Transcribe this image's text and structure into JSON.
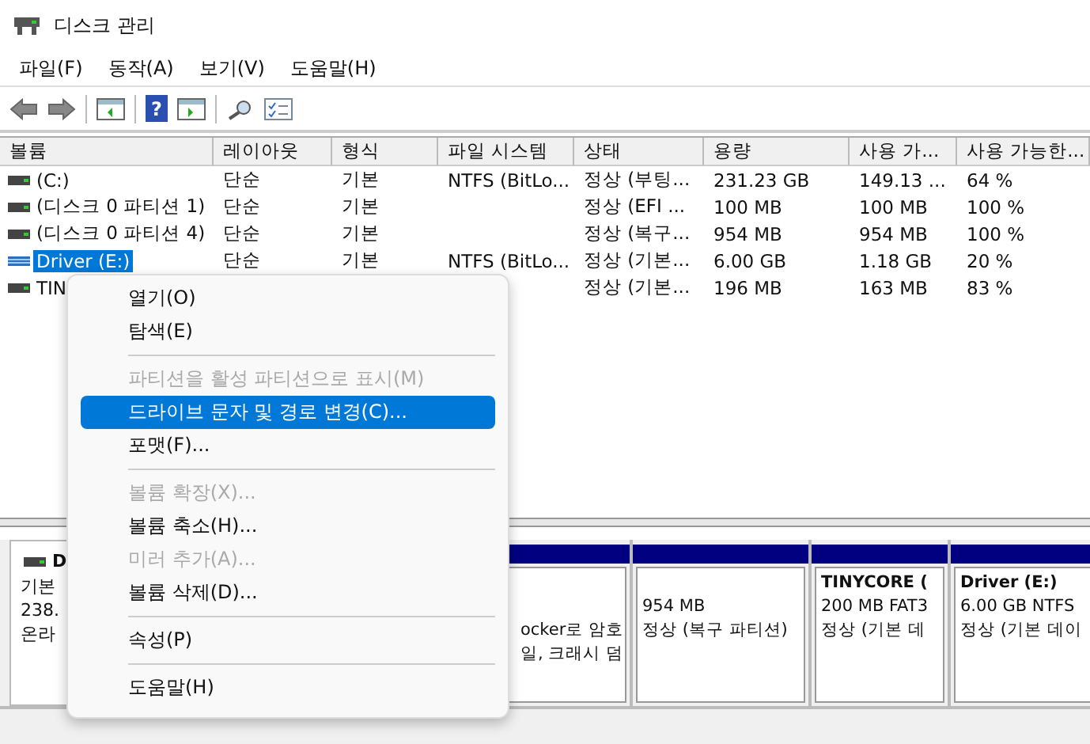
{
  "window": {
    "title": "디스크 관리"
  },
  "menu_bar": [
    "파일(F)",
    "동작(A)",
    "보기(V)",
    "도움말(H)"
  ],
  "toolbar": {
    "help_glyph": "?"
  },
  "table": {
    "columns": [
      "볼륨",
      "레이아웃",
      "형식",
      "파일 시스템",
      "상태",
      "용량",
      "사용 가...",
      "사용 가능한..."
    ],
    "rows": [
      {
        "cells": [
          "(C:)",
          "단순",
          "기본",
          "NTFS (BitLo...",
          "정상 (부팅...",
          "231.23 GB",
          "149.13 ...",
          "64 %"
        ],
        "selected": false,
        "kind": "plain"
      },
      {
        "cells": [
          "(디스크 0 파티션 1)",
          "단순",
          "기본",
          "",
          "정상 (EFI ...",
          "100 MB",
          "100 MB",
          "100 %"
        ],
        "selected": false,
        "kind": "plain"
      },
      {
        "cells": [
          "(디스크 0 파티션 4)",
          "단순",
          "기본",
          "",
          "정상 (복구...",
          "954 MB",
          "954 MB",
          "100 %"
        ],
        "selected": false,
        "kind": "plain"
      },
      {
        "cells": [
          "Driver (E:)",
          "단순",
          "기본",
          "NTFS (BitLo...",
          "정상 (기본...",
          "6.00 GB",
          "1.18 GB",
          "20 %"
        ],
        "selected": true,
        "kind": "striped"
      },
      {
        "cells": [
          "TIN",
          "",
          "",
          "",
          "정상 (기본...",
          "196 MB",
          "163 MB",
          "83 %"
        ],
        "selected": false,
        "kind": "plain"
      }
    ]
  },
  "context_menu": [
    {
      "kind": "item",
      "label": "열기(O)",
      "disabled": false,
      "selected": false
    },
    {
      "kind": "item",
      "label": "탐색(E)",
      "disabled": false,
      "selected": false
    },
    {
      "kind": "separator"
    },
    {
      "kind": "item",
      "label": "파티션을 활성 파티션으로 표시(M)",
      "disabled": true,
      "selected": false
    },
    {
      "kind": "item",
      "label": "드라이브 문자 및 경로 변경(C)...",
      "disabled": false,
      "selected": true
    },
    {
      "kind": "item",
      "label": "포맷(F)...",
      "disabled": false,
      "selected": false
    },
    {
      "kind": "separator"
    },
    {
      "kind": "item",
      "label": "볼륨 확장(X)...",
      "disabled": true,
      "selected": false
    },
    {
      "kind": "item",
      "label": "볼륨 축소(H)...",
      "disabled": false,
      "selected": false
    },
    {
      "kind": "item",
      "label": "미러 추가(A)...",
      "disabled": true,
      "selected": false
    },
    {
      "kind": "item",
      "label": "볼륨 삭제(D)...",
      "disabled": false,
      "selected": false
    },
    {
      "kind": "separator"
    },
    {
      "kind": "item",
      "label": "속성(P)",
      "disabled": false,
      "selected": false
    },
    {
      "kind": "separator"
    },
    {
      "kind": "item",
      "label": "도움말(H)",
      "disabled": false,
      "selected": false
    }
  ],
  "disk_map": {
    "disk": {
      "name": "D",
      "lines": [
        "기본",
        "238.",
        "온라"
      ]
    },
    "partitions": [
      {
        "lines": [
          "ocker로 암호",
          "일, 크래시 덤"
        ]
      },
      {
        "lines": [
          "954 MB",
          "정상 (복구 파티션)"
        ]
      },
      {
        "title": "TINYCORE  (",
        "lines": [
          "200 MB FAT3",
          "정상 (기본 데"
        ]
      },
      {
        "title": "Driver  (E:)",
        "lines": [
          "6.00 GB NTFS",
          "정상 (기본 데이"
        ]
      }
    ]
  }
}
